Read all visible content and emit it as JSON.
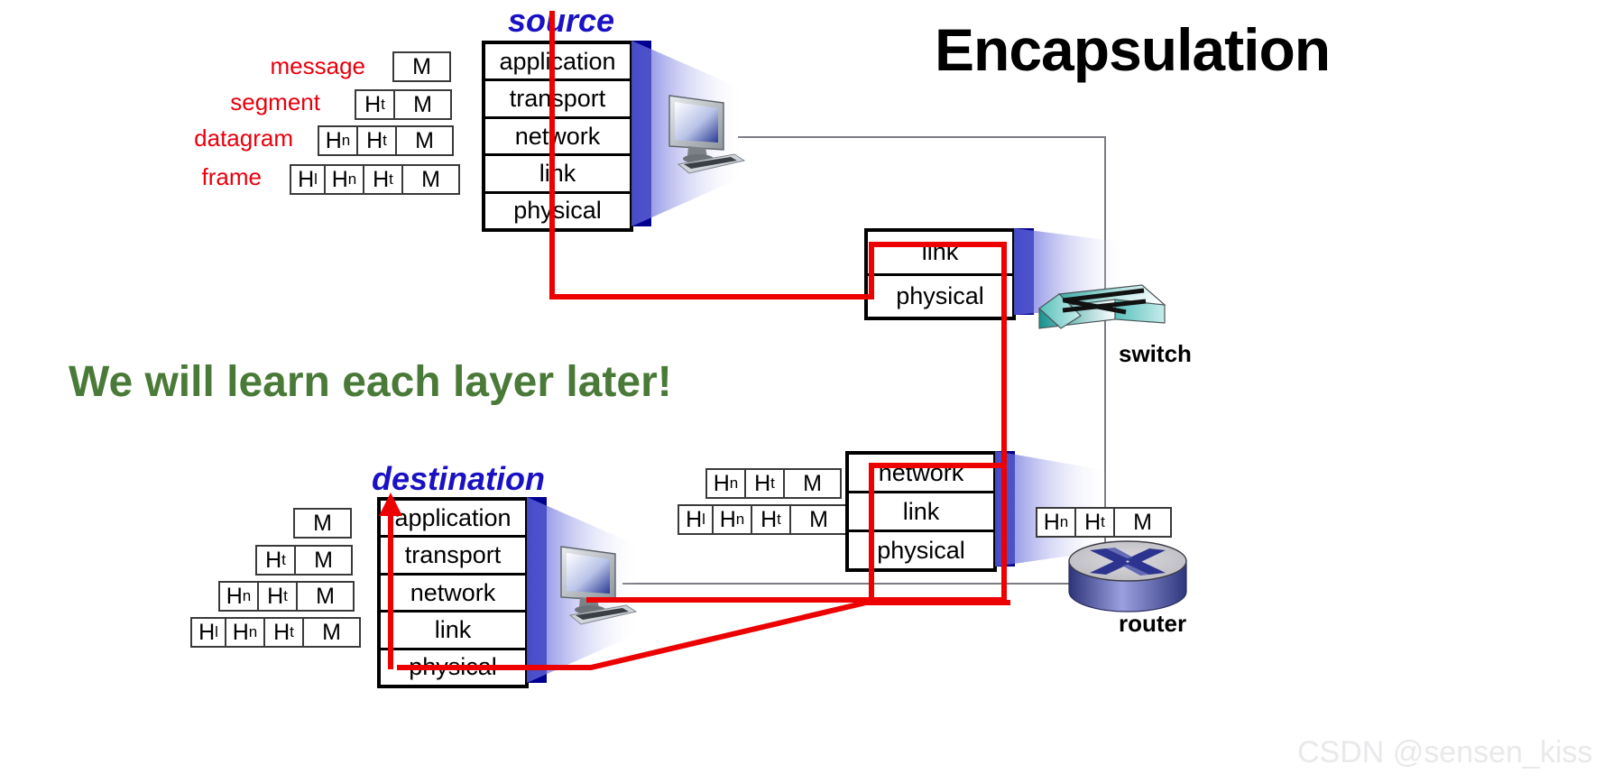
{
  "title": "Encapsulation",
  "note": "We will learn each layer later!",
  "watermark": "CSDN @sensen_kiss",
  "captions": {
    "source": "source",
    "destination": "destination"
  },
  "devices": {
    "switch": "switch",
    "router": "router"
  },
  "pdu_names": {
    "message": "message",
    "segment": "segment",
    "datagram": "datagram",
    "frame": "frame"
  },
  "headers": {
    "transport": "H",
    "transport_sub": "t",
    "network": "H",
    "network_sub": "n",
    "link": "H",
    "link_sub": "l",
    "payload": "M"
  },
  "stacks": {
    "source": {
      "layers": [
        "application",
        "transport",
        "network",
        "link",
        "physical"
      ]
    },
    "destination": {
      "layers": [
        "application",
        "transport",
        "network",
        "link",
        "physical"
      ]
    },
    "switch": {
      "layers": [
        "link",
        "physical"
      ]
    },
    "router": {
      "layers": [
        "network",
        "link",
        "physical"
      ]
    }
  },
  "colors": {
    "accent_red": "#ec0000",
    "caption_blue": "#1a11c4",
    "stack_blue": "#00009a",
    "green_text": "#4a7a37",
    "label_red": "#e8000d",
    "gray_link": "#7b7b84",
    "switch_teal": "#2fb4ad",
    "router_blue": "#3b3f9e"
  },
  "chart_data": {
    "type": "diagram",
    "title": "Encapsulation",
    "nodes": [
      {
        "id": "source",
        "label": "source",
        "layers": [
          "application",
          "transport",
          "network",
          "link",
          "physical"
        ]
      },
      {
        "id": "switch",
        "label": "switch",
        "layers": [
          "link",
          "physical"
        ]
      },
      {
        "id": "router",
        "label": "router",
        "layers": [
          "network",
          "link",
          "physical"
        ]
      },
      {
        "id": "destination",
        "label": "destination",
        "layers": [
          "application",
          "transport",
          "network",
          "link",
          "physical"
        ]
      }
    ],
    "pdus": [
      {
        "name": "message",
        "fields": [
          "M"
        ]
      },
      {
        "name": "segment",
        "fields": [
          "Ht",
          "M"
        ]
      },
      {
        "name": "datagram",
        "fields": [
          "Hn",
          "Ht",
          "M"
        ]
      },
      {
        "name": "frame",
        "fields": [
          "Hl",
          "Hn",
          "Ht",
          "M"
        ]
      }
    ],
    "path": [
      "source",
      "switch",
      "router",
      "destination"
    ]
  }
}
